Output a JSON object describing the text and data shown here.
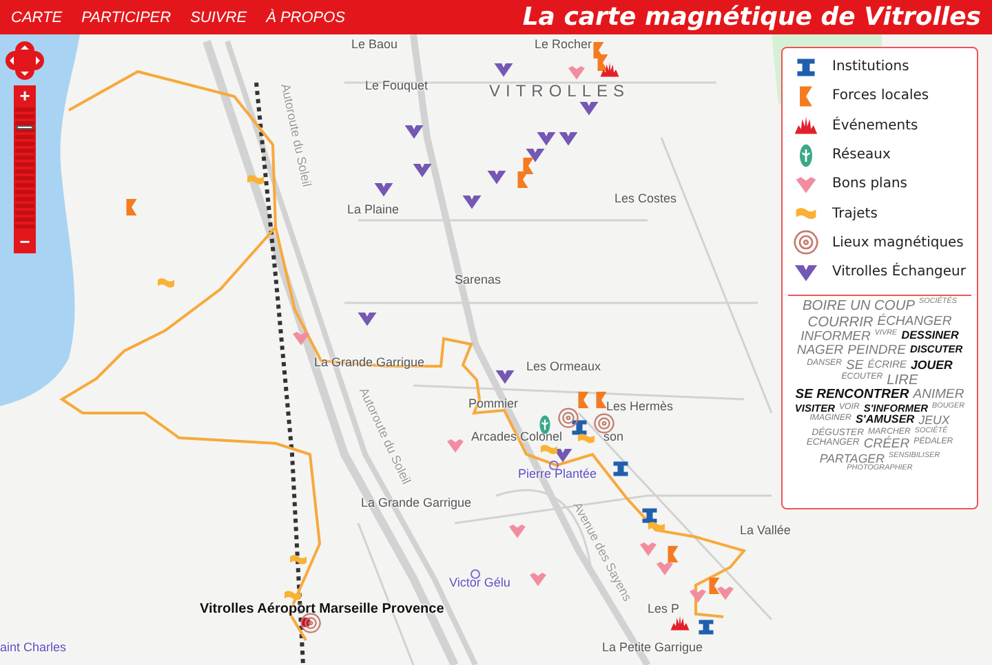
{
  "nav": {
    "links": [
      "CARTE",
      "PARTICIPER",
      "SUIVRE",
      "À PROPOS"
    ],
    "title": "La carte magnétique de Vitrolles"
  },
  "zoom": {
    "plus": "+",
    "minus": "−",
    "level": 0.82
  },
  "map": {
    "labels": [
      {
        "text": "Le Baou",
        "kind": "place"
      },
      {
        "text": "Le Rocher",
        "kind": "place"
      },
      {
        "text": "Le Fouquet",
        "kind": "place"
      },
      {
        "text": "VITROLLES",
        "kind": "town"
      },
      {
        "text": "La Plaine",
        "kind": "place"
      },
      {
        "text": "Les Costes",
        "kind": "place"
      },
      {
        "text": "Sarenas",
        "kind": "place"
      },
      {
        "text": "Les Ormeaux",
        "kind": "place"
      },
      {
        "text": "La Grande Garrigue",
        "kind": "place"
      },
      {
        "text": "Pommier",
        "kind": "place"
      },
      {
        "text": "Les Hermès",
        "kind": "place"
      },
      {
        "text": "Arcades Colonel",
        "kind": "place"
      },
      {
        "text": "son",
        "kind": "place"
      },
      {
        "text": "Pierre Plantée",
        "kind": "stop"
      },
      {
        "text": "La Grande Garrigue",
        "kind": "place"
      },
      {
        "text": "La Vallée",
        "kind": "place"
      },
      {
        "text": "Victor Gélu",
        "kind": "stop"
      },
      {
        "text": "Vitrolles Aéroport Marseille Provence",
        "kind": "station"
      },
      {
        "text": "Les P",
        "kind": "place"
      },
      {
        "text": "aint Charles",
        "kind": "stop"
      },
      {
        "text": "La Petite Garrigue",
        "kind": "place"
      },
      {
        "text": "Autoroute du Soleil",
        "kind": "road"
      },
      {
        "text": "Autoroute du Soleil",
        "kind": "road"
      },
      {
        "text": "Avenue des Sayens",
        "kind": "road"
      }
    ]
  },
  "legend": {
    "items": [
      {
        "label": "Institutions",
        "kind": "institution"
      },
      {
        "label": "Forces locales",
        "kind": "force"
      },
      {
        "label": "Événements",
        "kind": "event"
      },
      {
        "label": "Réseaux",
        "kind": "network"
      },
      {
        "label": "Bons plans",
        "kind": "deal"
      },
      {
        "label": "Trajets",
        "kind": "route"
      },
      {
        "label": "Lieux magnétiques",
        "kind": "place"
      },
      {
        "label": "Vitrolles Échangeur",
        "kind": "exchanger"
      }
    ],
    "word_cloud": [
      {
        "text": "BOIRE UN COUP",
        "dark": false
      },
      {
        "text": "SOCIÉTÉS",
        "dark": false
      },
      {
        "text": "COURRIR",
        "dark": false
      },
      {
        "text": "ÉCHANGER",
        "dark": false
      },
      {
        "text": "INFORMER",
        "dark": false
      },
      {
        "text": "VIVRE",
        "dark": false
      },
      {
        "text": "DESSINER",
        "dark": true
      },
      {
        "text": "NAGER",
        "dark": false
      },
      {
        "text": "PEINDRE",
        "dark": false
      },
      {
        "text": "DISCUTER",
        "dark": true
      },
      {
        "text": "DANSER",
        "dark": false
      },
      {
        "text": "SE",
        "dark": false
      },
      {
        "text": "ÉCRIRE",
        "dark": false
      },
      {
        "text": "JOUER",
        "dark": true
      },
      {
        "text": "ÉCOUTER",
        "dark": false
      },
      {
        "text": "LIRE",
        "dark": false
      },
      {
        "text": "SE RENCONTRER",
        "dark": true
      },
      {
        "text": "ANIMER",
        "dark": false
      },
      {
        "text": "VISITER",
        "dark": true
      },
      {
        "text": "VOIR",
        "dark": false
      },
      {
        "text": "S'INFORMER",
        "dark": true
      },
      {
        "text": "BOUGER",
        "dark": false
      },
      {
        "text": "IMAGINER",
        "dark": false
      },
      {
        "text": "S'AMUSER",
        "dark": true
      },
      {
        "text": "JEUX",
        "dark": false
      },
      {
        "text": "DÉGUSTER",
        "dark": false
      },
      {
        "text": "MARCHER",
        "dark": false
      },
      {
        "text": "SOCIÉTÉ",
        "dark": false
      },
      {
        "text": "ECHANGER",
        "dark": false
      },
      {
        "text": "CRÉER",
        "dark": false
      },
      {
        "text": "PÉDALER",
        "dark": false
      },
      {
        "text": "PARTAGER",
        "dark": false
      },
      {
        "text": "SENSIBILISER",
        "dark": false
      },
      {
        "text": "PHOTOGRAPHIER",
        "dark": false
      }
    ]
  }
}
